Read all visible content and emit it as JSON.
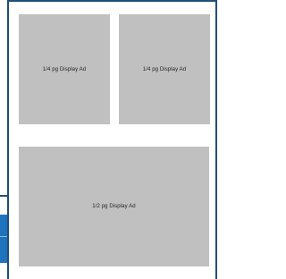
{
  "ads": [
    {
      "label": "1/4 pg Display Ad"
    },
    {
      "label": "1/4 pg Display Ad"
    },
    {
      "label": "1/2 pg Display Ad"
    }
  ],
  "colors": {
    "frame": "#1f4e78",
    "ad_fill": "#c0c0c0",
    "edge_tab": "#1e73be"
  }
}
